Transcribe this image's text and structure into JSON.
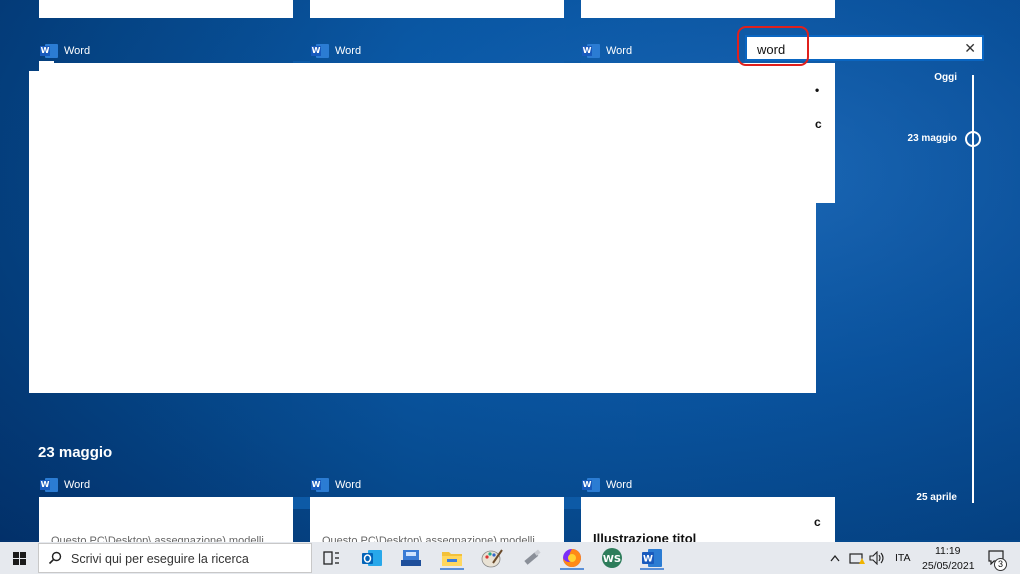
{
  "timeline_view": {
    "top_cards": [
      {
        "app": "Word"
      },
      {
        "app": "Word"
      },
      {
        "app": "Word"
      }
    ],
    "search": {
      "value": "word",
      "clear_icon": "close-icon"
    },
    "timeline": {
      "labels": [
        "Oggi",
        "23 maggio",
        "25 aprile"
      ]
    },
    "section": {
      "title": "23 maggio",
      "cards": [
        {
          "app": "Word",
          "snippet": "Questo PC\\Desktop\\ assegnazione) modelli"
        },
        {
          "app": "Word",
          "snippet": "Questo PC\\Desktop\\ assegnazione) modelli"
        },
        {
          "app": "Word",
          "snippet": "Illustrazione titol"
        }
      ]
    }
  },
  "taskbar": {
    "search_placeholder": "Scrivi qui per eseguire la ricerca",
    "pinned": [
      {
        "icon": "task-view-icon"
      },
      {
        "icon": "outlook-icon"
      },
      {
        "icon": "scan-icon"
      },
      {
        "icon": "file-explorer-icon"
      },
      {
        "icon": "paint-icon"
      },
      {
        "icon": "usb-tool-icon"
      },
      {
        "icon": "firefox-icon"
      },
      {
        "icon": "ws-app-icon"
      },
      {
        "icon": "word-icon"
      }
    ],
    "tray": {
      "language": "ITA",
      "time": "11:19",
      "date": "25/05/2021",
      "notifications": "3"
    }
  },
  "colors": {
    "accent": "#0a66c2",
    "highlight": "#e0201c",
    "word_blue": "#185abd"
  }
}
